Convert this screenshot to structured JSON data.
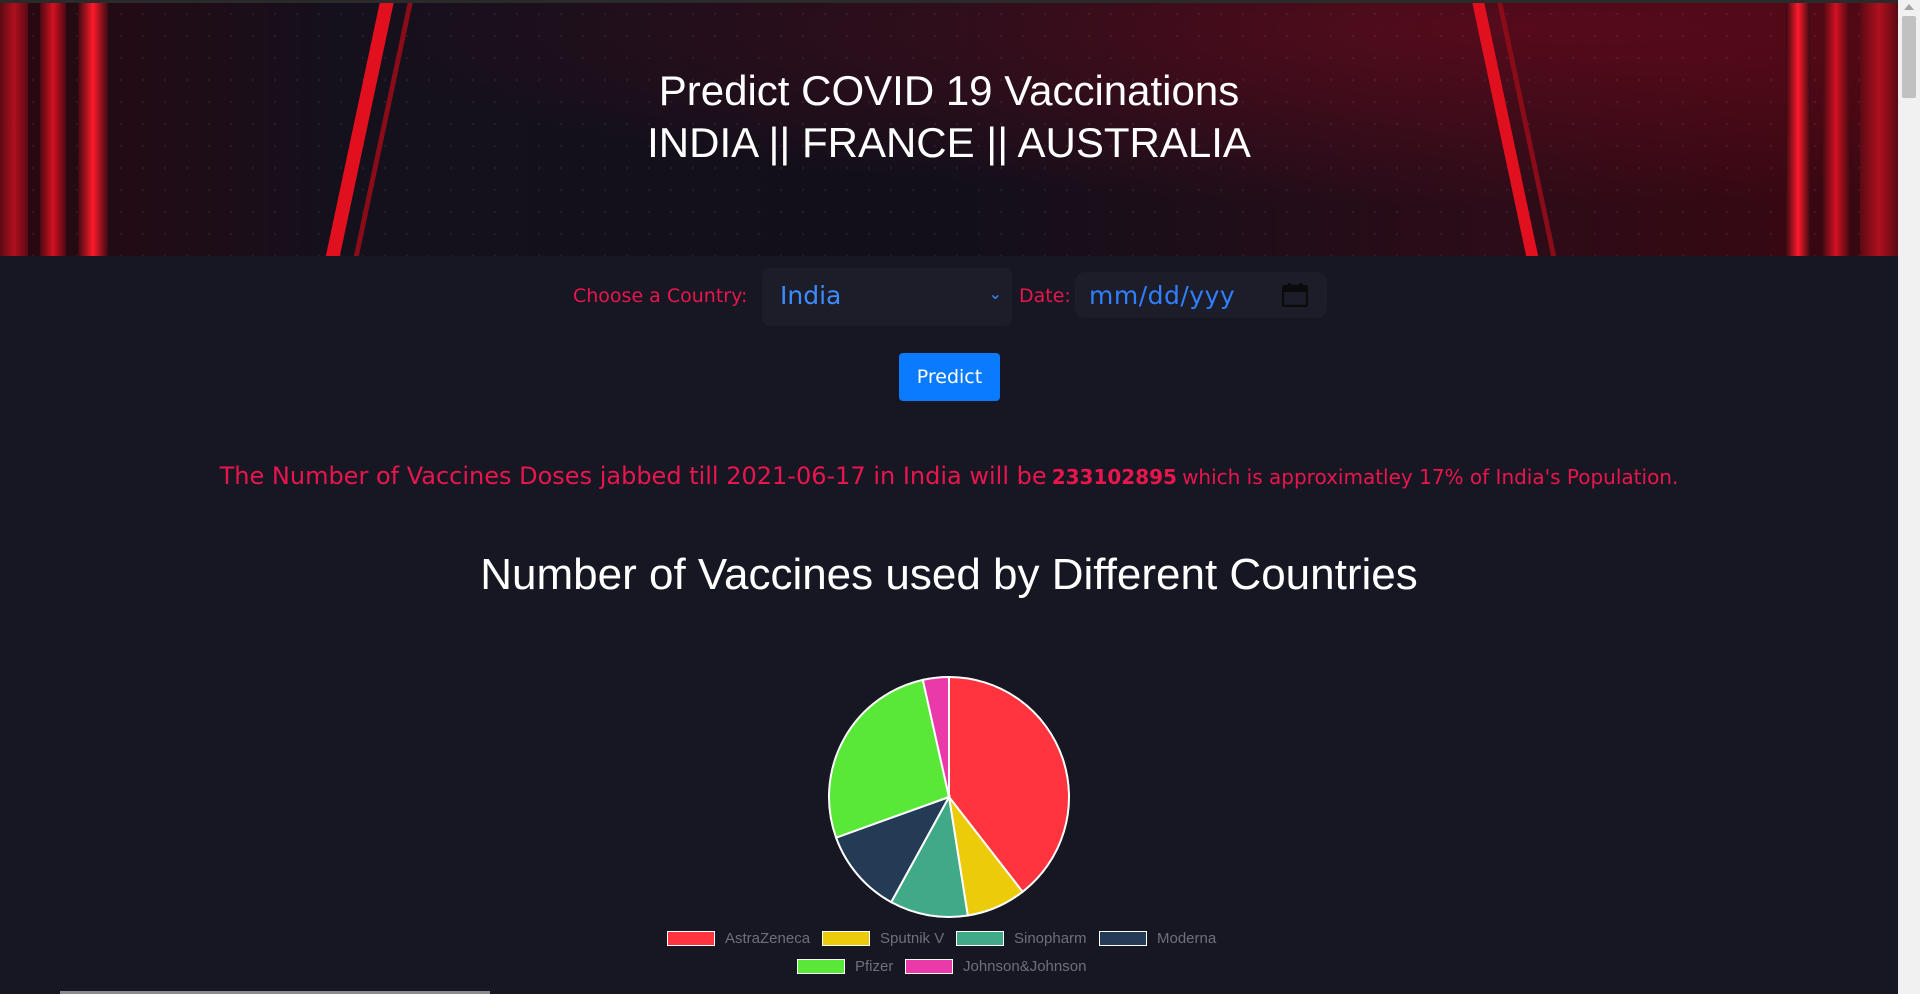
{
  "header": {
    "title_line1": "Predict COVID 19 Vaccinations",
    "title_line2": "INDIA || FRANCE || AUSTRALIA"
  },
  "form": {
    "country_label": "Choose a Country:",
    "country_value": "India",
    "date_label": "Date:",
    "date_placeholder": "mm/dd/yyy",
    "predict_label": "Predict"
  },
  "result": {
    "prefix": "The Number of Vaccines Doses jabbed till 2021-06-17 in India will be",
    "doses": "233102895",
    "suffix": "which is approximatley 17% of India's Population."
  },
  "colors": {
    "accent_red": "#e8164c",
    "button_blue": "#0a7bff"
  },
  "chart_data": {
    "type": "pie",
    "title": "Number of Vaccines used by Different Countries",
    "categories": [
      "AstraZeneca",
      "Sputnik V",
      "Sinopharm",
      "Moderna",
      "Pfizer",
      "Johnson&Johnson"
    ],
    "values": [
      39.5,
      8,
      10.5,
      11.5,
      27,
      3.5
    ],
    "colors": [
      "#ff343e",
      "#eccb0b",
      "#40a987",
      "#243b56",
      "#5ae838",
      "#ea3aaa"
    ],
    "legend_position": "bottom"
  }
}
